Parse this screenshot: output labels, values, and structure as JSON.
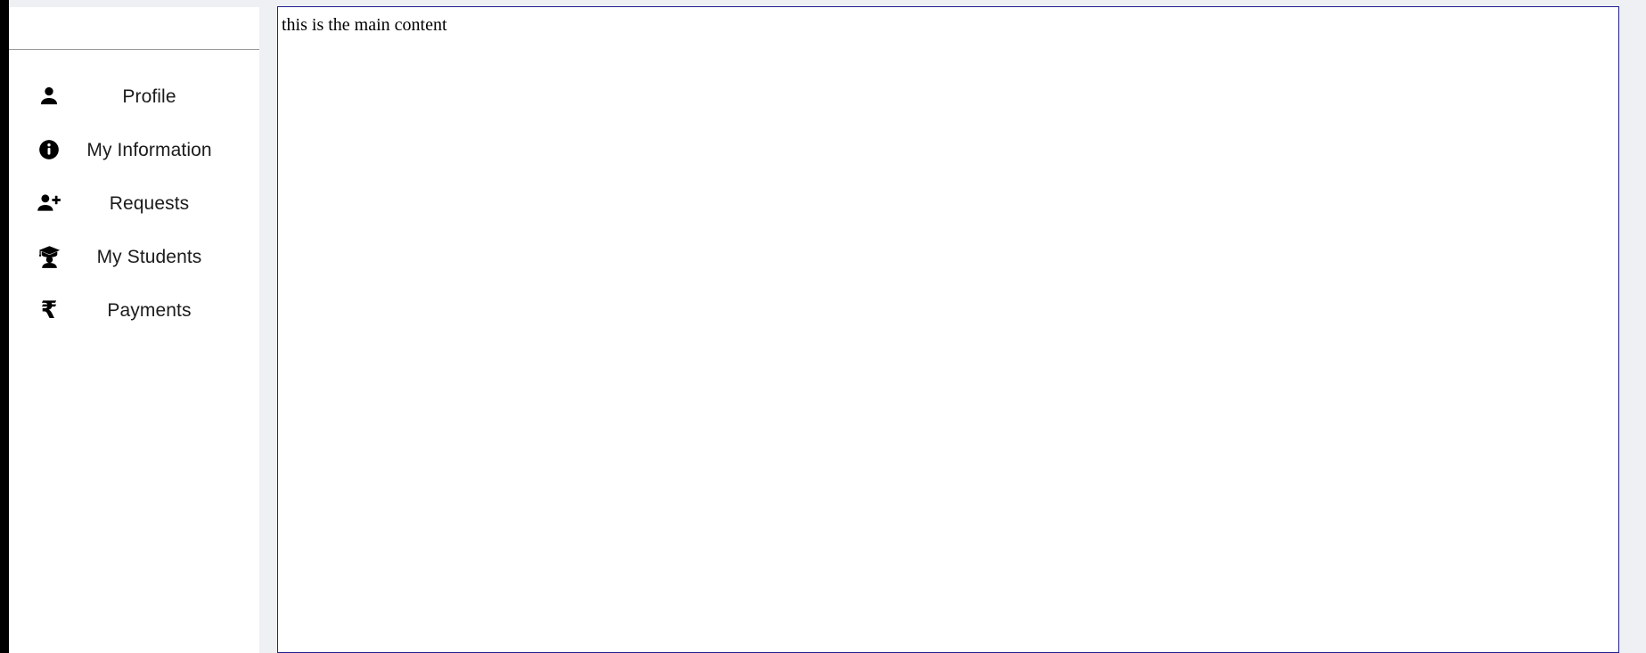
{
  "window": {
    "background_color": "#eef0f4",
    "rail_color": "#000000"
  },
  "sidebar": {
    "background_color": "#ffffff",
    "header": {
      "title": ""
    },
    "items": [
      {
        "label": "Profile",
        "icon": "user-icon"
      },
      {
        "label": "My Information",
        "icon": "info-circle-icon"
      },
      {
        "label": "Requests",
        "icon": "user-plus-icon"
      },
      {
        "label": "My Students",
        "icon": "user-graduate-icon"
      },
      {
        "label": "Payments",
        "icon": "rupee-sign-icon",
        "glyph": "₹"
      }
    ]
  },
  "main": {
    "border_color": "#20208c",
    "background_color": "#ffffff",
    "text": "this is the main content"
  }
}
